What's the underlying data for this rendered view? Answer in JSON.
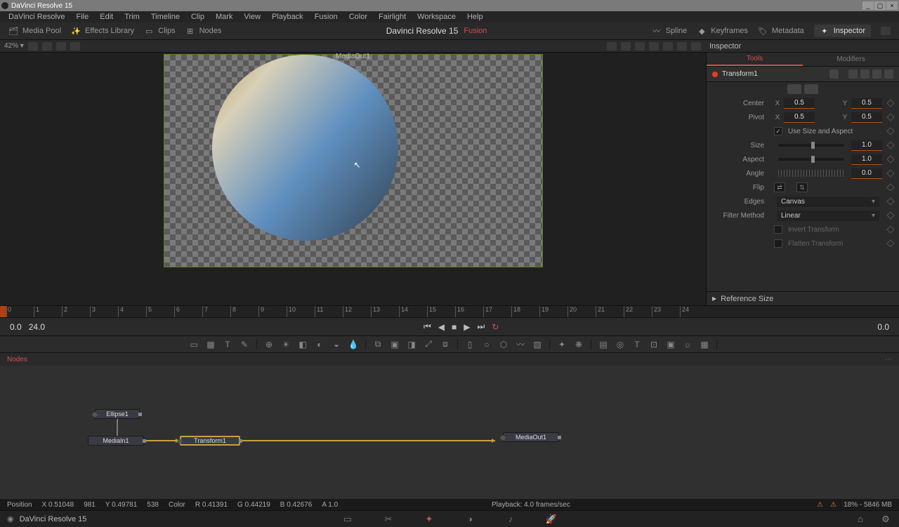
{
  "title": "DaVinci Resolve 15",
  "menu": [
    "DaVinci Resolve",
    "File",
    "Edit",
    "Trim",
    "Timeline",
    "Clip",
    "Mark",
    "View",
    "Playback",
    "Fusion",
    "Color",
    "Fairlight",
    "Workspace",
    "Help"
  ],
  "pages": {
    "left": [
      {
        "name": "media-pool",
        "label": "Media Pool"
      },
      {
        "name": "effects-library",
        "label": "Effects Library"
      },
      {
        "name": "clips",
        "label": "Clips"
      },
      {
        "name": "nodes",
        "label": "Nodes"
      }
    ],
    "center_title": "Davinci Resolve 15",
    "center_badge": "Fusion",
    "right": [
      {
        "name": "spline",
        "label": "Spline"
      },
      {
        "name": "keyframes",
        "label": "Keyframes"
      },
      {
        "name": "metadata",
        "label": "Metadata"
      },
      {
        "name": "inspector",
        "label": "Inspector"
      }
    ]
  },
  "zoom": "42% ▾",
  "viewer_label": "MediaOut1",
  "inspector": {
    "header": "Inspector",
    "tabs": {
      "tools": "Tools",
      "modifiers": "Modifiers"
    },
    "node": "Transform1",
    "params": {
      "center_label": "Center",
      "center_x": "0.5",
      "center_y": "0.5",
      "pivot_label": "Pivot",
      "pivot_x": "0.5",
      "pivot_y": "0.5",
      "use_size": "Use Size and Aspect",
      "size_label": "Size",
      "size_val": "1.0",
      "aspect_label": "Aspect",
      "aspect_val": "1.0",
      "angle_label": "Angle",
      "angle_val": "0.0",
      "flip_label": "Flip",
      "edges_label": "Edges",
      "edges_val": "Canvas",
      "filter_label": "Filter Method",
      "filter_val": "Linear",
      "invert": "Invert Transform",
      "flatten": "Flatten Transform",
      "refsize": "Reference Size"
    }
  },
  "ruler": [
    "0",
    "1",
    "2",
    "3",
    "4",
    "5",
    "6",
    "7",
    "8",
    "9",
    "10",
    "11",
    "12",
    "13",
    "14",
    "15",
    "16",
    "17",
    "18",
    "19",
    "20",
    "21",
    "22",
    "23",
    "24"
  ],
  "transport": {
    "start": "0.0",
    "end": "24.0",
    "pos": "0.0"
  },
  "nodes_panel": "Nodes",
  "nodes": {
    "ellipse": "Ellipse1",
    "mediain": "MediaIn1",
    "transform": "Transform1",
    "mediaout": "MediaOut1"
  },
  "status": {
    "pos_label": "Position",
    "pos_x": "X 0.51048",
    "pos_px_x": "981",
    "pos_y": "Y 0.49781",
    "pos_px_y": "538",
    "color_label": "Color",
    "r": "R 0.41391",
    "g": "G 0.44219",
    "b": "B 0.42676",
    "a": "A  1.0",
    "playback": "Playback: 4.0 frames/sec",
    "mem": "18% - 5846 MB"
  },
  "bottom_title": "DaVinci Resolve 15"
}
